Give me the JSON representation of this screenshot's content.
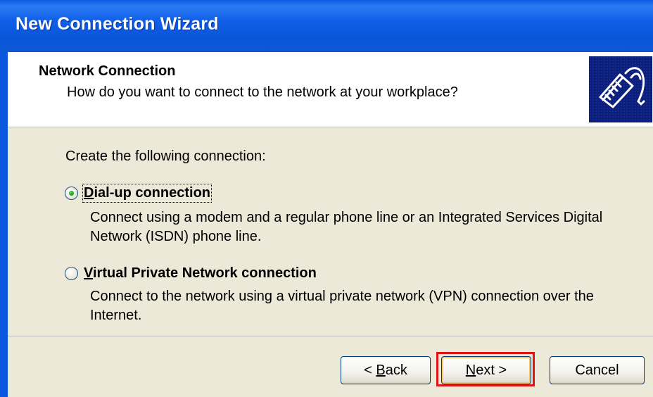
{
  "window": {
    "title": "New Connection Wizard"
  },
  "header": {
    "title": "Network Connection",
    "subtitle": "How do you want to connect to the network at your workplace?",
    "icon": "network-cable-icon"
  },
  "body": {
    "prompt": "Create the following connection:",
    "options": [
      {
        "label_prefix": "D",
        "label_rest": "ial-up connection",
        "selected": true,
        "description": "Connect using a modem and a regular phone line or an Integrated Services Digital Network (ISDN) phone line."
      },
      {
        "label_prefix": "V",
        "label_rest": "irtual Private Network connection",
        "selected": false,
        "description": "Connect to the network using a virtual private network (VPN) connection over the Internet."
      }
    ]
  },
  "buttons": {
    "back_arrow": "<",
    "back_prefix": "B",
    "back_rest": "ack",
    "next_prefix": "N",
    "next_rest": "ext",
    "next_arrow": ">",
    "cancel": "Cancel"
  },
  "colors": {
    "titlebar": "#0A5AE0",
    "dialog_bg": "#ECE9D8",
    "highlight": "#E01414",
    "radio_dot": "#21A121"
  }
}
